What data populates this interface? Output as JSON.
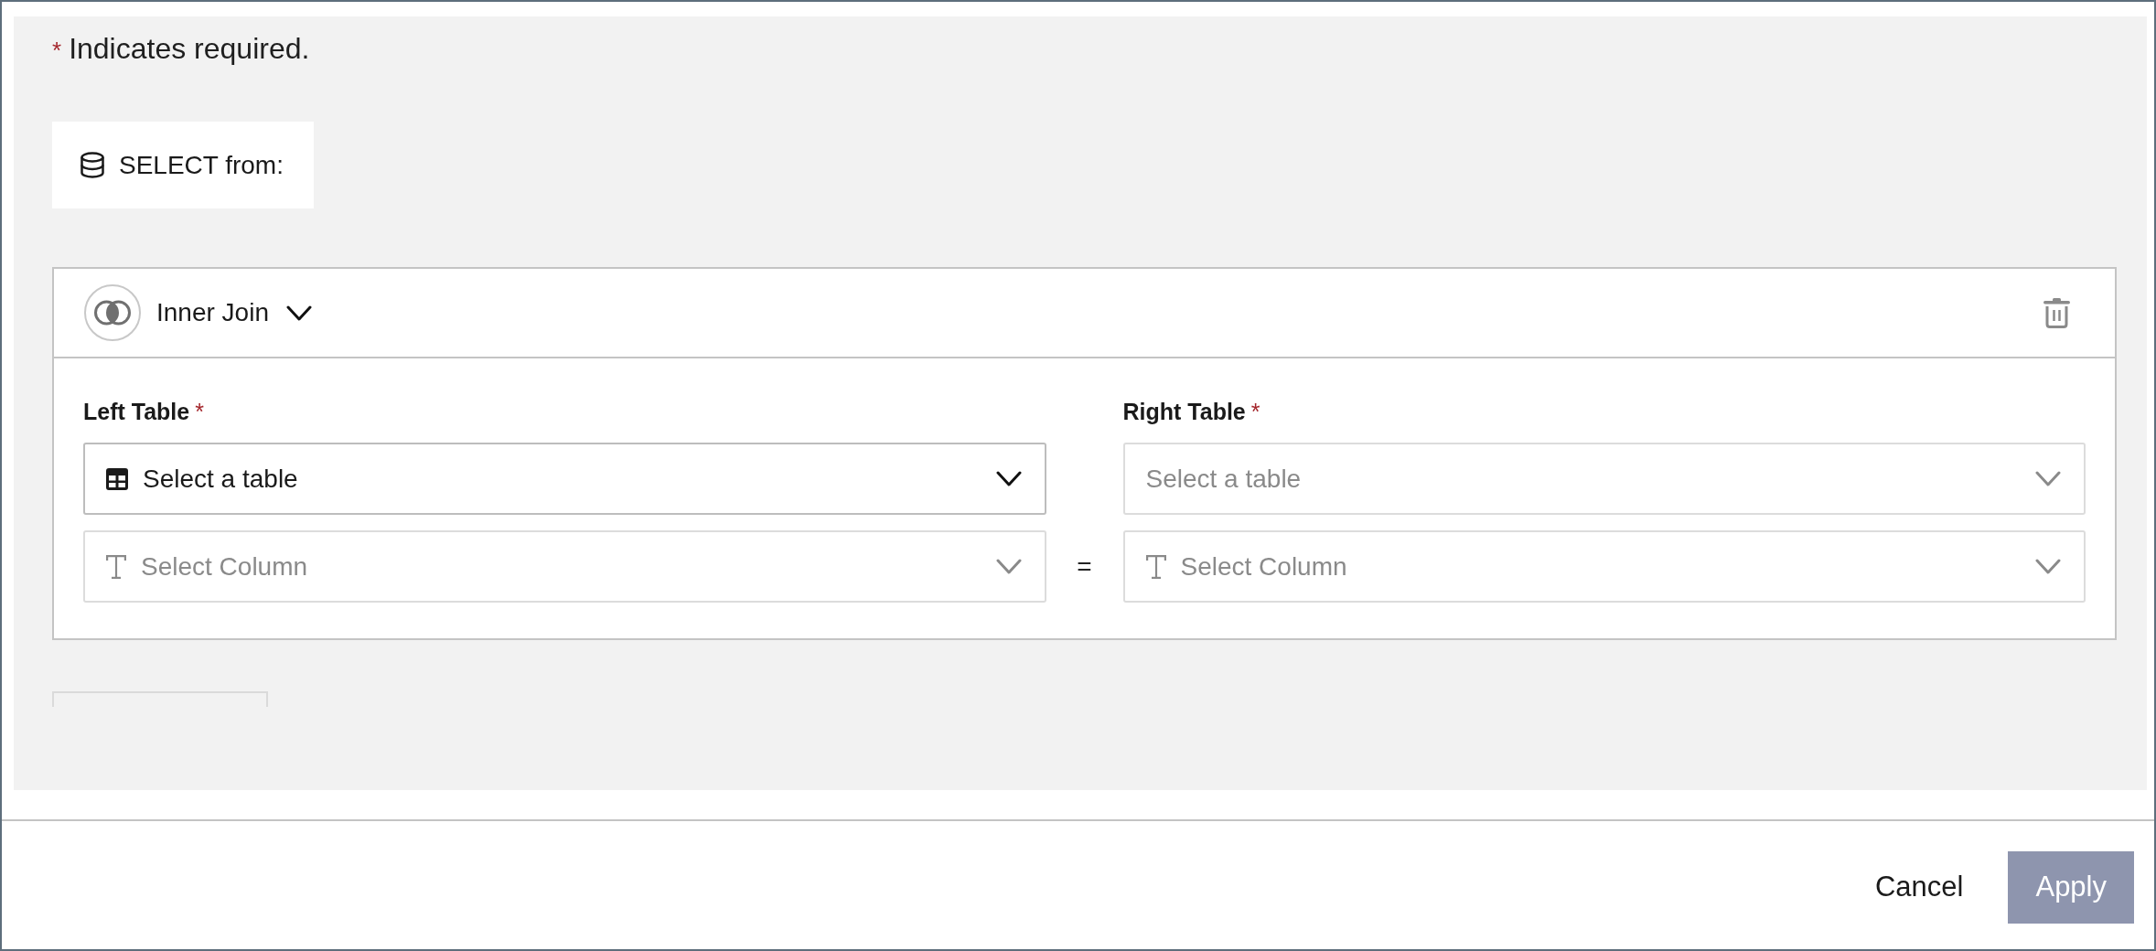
{
  "required_note": {
    "marker": "*",
    "text": "Indicates required."
  },
  "source": {
    "label": "SELECT from:"
  },
  "join": {
    "type_label": "Inner Join",
    "left": {
      "label": "Left Table",
      "required_marker": "*",
      "table_select": {
        "kind": "table",
        "placeholder": "Select a table",
        "disabled": false
      },
      "column_select": {
        "kind": "column",
        "placeholder": "Select Column",
        "disabled": true
      }
    },
    "operator": "=",
    "right": {
      "label": "Right Table",
      "required_marker": "*",
      "table_select": {
        "placeholder": "Select a table",
        "disabled": true
      },
      "column_select": {
        "kind": "column",
        "placeholder": "Select Column",
        "disabled": true
      }
    }
  },
  "footer": {
    "buttons": [
      {
        "label": "Cancel",
        "kind": "secondary",
        "disabled": false
      },
      {
        "label": "Apply",
        "kind": "primary",
        "disabled": true
      }
    ]
  }
}
